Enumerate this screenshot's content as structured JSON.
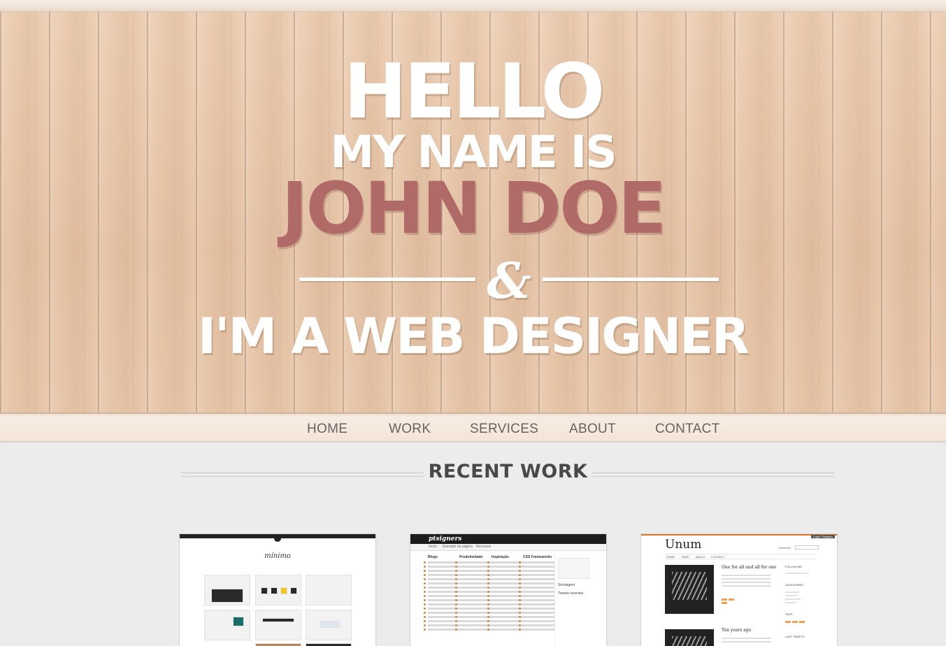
{
  "hero": {
    "hello": "HELLO",
    "my_name_is": "MY NAME IS",
    "name": "JOHN DOE",
    "ampersand": "&",
    "role": "I'M A WEB DESIGNER"
  },
  "nav": {
    "items": [
      {
        "label": "HOME"
      },
      {
        "label": "WORK"
      },
      {
        "label": "SERVICES"
      },
      {
        "label": "ABOUT"
      },
      {
        "label": "CONTACT"
      }
    ]
  },
  "recent_work": {
    "title": "RECENT WORK",
    "items": [
      {
        "logo": "mínimo"
      },
      {
        "logo": "ptsigners",
        "sub_links": [
          "Início",
          "Exemplo de página",
          "Recursos"
        ],
        "columns": [
          "Blogs",
          "Produtividade",
          "Inspiração",
          "CSS Frameworks"
        ],
        "side_titles": [
          "Sondagem",
          "Tweets recentes"
        ]
      },
      {
        "logo": "Unum",
        "nav_links": [
          "HOME",
          "PAGE",
          "ABOUT",
          "CONTACT"
        ],
        "posts": [
          "One for all and all for one",
          "Ten years ago"
        ],
        "subscribe": "Subscribe",
        "login": "Login / Register",
        "sidebar_titles": [
          "FOLLOW ME",
          "CATEGORIES",
          "TAGS",
          "LAST TWEETS"
        ]
      }
    ]
  },
  "colors": {
    "accent_name": "#b06a68",
    "hero_text": "#ffffff",
    "title_text": "#4a4847",
    "nav_text": "#6b6160"
  }
}
